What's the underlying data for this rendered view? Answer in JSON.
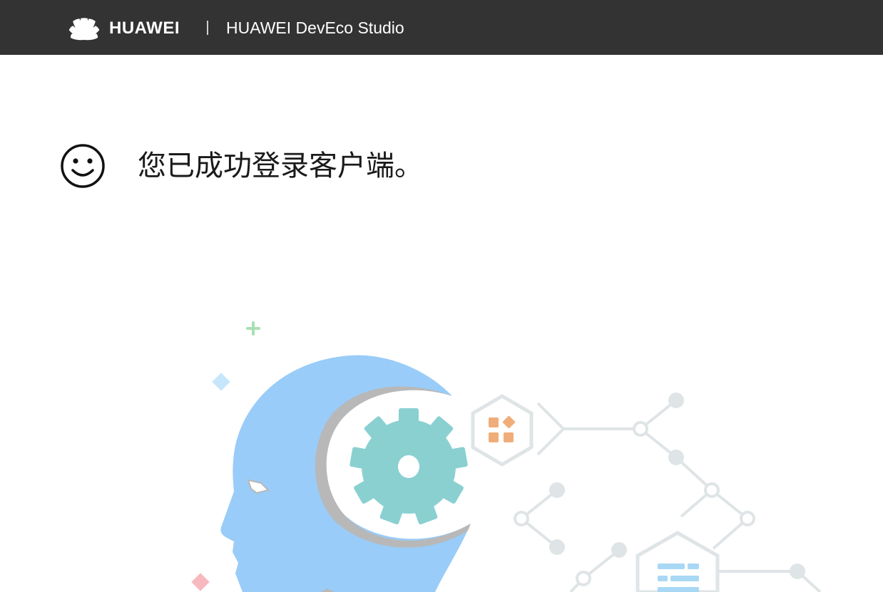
{
  "header": {
    "brand_name": "HUAWEI",
    "product_title": "HUAWEI DevEco Studio"
  },
  "main": {
    "status_icon": "smiley-face-icon",
    "message": "您已成功登录客户端。"
  },
  "illustration": {
    "description_icons": [
      "head-silhouette-icon",
      "gear-icon",
      "app-grid-icon",
      "list-icon",
      "network-nodes-icon"
    ],
    "colors": {
      "head": "#99ccf8",
      "head_shadow": "#b8b8b8",
      "gear": "#8ad0d1",
      "app_icon": "#f0ad7a",
      "list_icon": "#a9d8f5",
      "network": "#dfe4e6",
      "plus": "#a8e0b4",
      "diamond_blue": "#c8e6fb",
      "diamond_pink": "#f7b9bf"
    }
  }
}
